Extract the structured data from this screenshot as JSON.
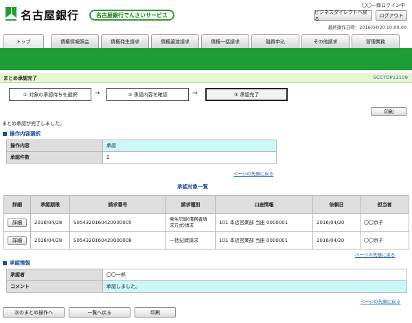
{
  "header": {
    "bank_name": "名古屋銀行",
    "service_name": "名古屋銀行でんさいサービス",
    "user_login": "〇〇一郎ログイン中",
    "btn_business_direct": "ビジネスダイレクトへ戻る",
    "btn_logout": "ログアウト",
    "last_operation": "最終操作日時：2016/04/20 10:00:00"
  },
  "tabs": [
    "トップ",
    "債権情報照会",
    "債権発生請求",
    "債権譲渡請求",
    "債権一括請求",
    "融資申込",
    "その他請求",
    "管理業務"
  ],
  "page": {
    "title": "まとめ承認完了",
    "code": "SCCTOP11109"
  },
  "steps": [
    "① 対象の承認待ちを選択",
    "② 承認内容を確認",
    "③ 承認完了"
  ],
  "print_label": "印刷",
  "completion_message": "まとめ承認が完了しました。",
  "operation": {
    "section_title": "操作内容選択",
    "rows": [
      {
        "label": "操作内容",
        "value": "承認"
      },
      {
        "label": "承認件数",
        "value": "2"
      }
    ],
    "back_to_top": "ページの先頭に戻る"
  },
  "approval_list": {
    "title": "承認対象一覧",
    "headers": [
      "詳細",
      "承認期限",
      "請求番号",
      "請求種別",
      "口座情報",
      "依頼日",
      "担当者"
    ],
    "detail_button": "詳細",
    "rows": [
      {
        "deadline": "2016/04/28",
        "request_no": "S054320160420000005",
        "type": "発生記録(債務者請求方式)請求",
        "account": "101 本店営業部 当座 0000001",
        "request_date": "2016/04/20",
        "person": "〇〇京子"
      },
      {
        "deadline": "2016/04/28",
        "request_no": "S054320160420000008",
        "type": "一括記録請求",
        "account": "101 本店営業部 当座 0000001",
        "request_date": "2016/04/20",
        "person": "〇〇京子"
      }
    ],
    "back_to_top": "ページの先頭に戻る"
  },
  "approval_info": {
    "section_title": "承認情報",
    "rows": [
      {
        "label": "承認者",
        "value": "〇〇一郎"
      },
      {
        "label": "コメント",
        "value": "承認しました。"
      }
    ],
    "back_to_top": "ページの先頭に戻る"
  },
  "bottom_buttons": [
    "次のまとめ操作へ",
    "一覧へ戻る",
    "印刷"
  ],
  "colors": {
    "brand_green": "#1f9e35",
    "link_blue": "#1a5fb0",
    "section_blue": "#1d4f9c",
    "highlight_cyan": "#ccf7f7"
  }
}
